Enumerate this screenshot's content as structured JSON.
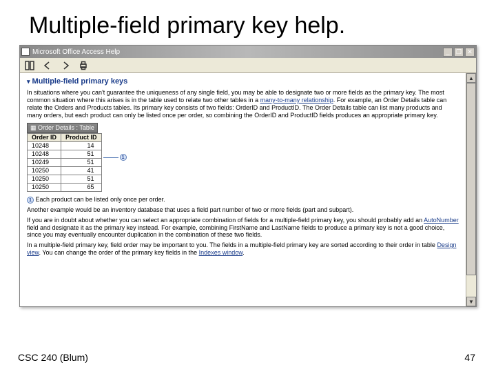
{
  "slide": {
    "title": "Multiple-field primary key help.",
    "footer_left": "CSC 240 (Blum)",
    "footer_right": "47"
  },
  "window": {
    "title": "Microsoft Office Access Help",
    "min_label": "_",
    "restore_label": "❐",
    "close_label": "✕"
  },
  "help": {
    "heading": "Multiple-field primary keys",
    "para1_a": "In situations where you can't guarantee the uniqueness of any single field, you may be able to designate two or more fields as the primary key. The most common situation where this arises is in the table used to relate two other tables in a ",
    "link_m2m": "many-to-many relationship",
    "para1_b": ". For example, an Order Details table can relate the Orders and Products tables. Its primary key consists of two fields: OrderID and ProductID. The Order Details table can list many products and many orders, but each product can only be listed once per order, so combining the OrderID and ProductID fields produces an appropriate primary key.",
    "callout_num": "1",
    "callout_text": "Each product can be listed only once per order.",
    "para2": "Another example would be an inventory database that uses a field part number of two or more fields (part and subpart).",
    "para3_a": "If you are in doubt about whether you can select an appropriate combination of fields for a multiple-field primary key, you should probably add an ",
    "link_autonum": "AutoNumber",
    "para3_b": " field and designate it as the primary key instead. For example, combining FirstName and LastName fields to produce a primary key is not a good choice, since you may eventually encounter duplication in the combination of these two fields.",
    "para4_a": "In a multiple-field primary key, field order may be important to you. The fields in a multiple-field primary key are sorted according to their order in table ",
    "link_design": "Design view",
    "para4_b": ". You can change the order of the primary key fields in the ",
    "link_indexes": "Indexes window",
    "para4_c": "."
  },
  "example_table": {
    "window_title": "Order Details : Table",
    "col1": "Order ID",
    "col2": "Product ID",
    "rows": [
      {
        "o": "10248",
        "p": "14"
      },
      {
        "o": "10248",
        "p": "51"
      },
      {
        "o": "10249",
        "p": "51"
      },
      {
        "o": "10250",
        "p": "41"
      },
      {
        "o": "10250",
        "p": "51"
      },
      {
        "o": "10250",
        "p": "65"
      }
    ]
  }
}
